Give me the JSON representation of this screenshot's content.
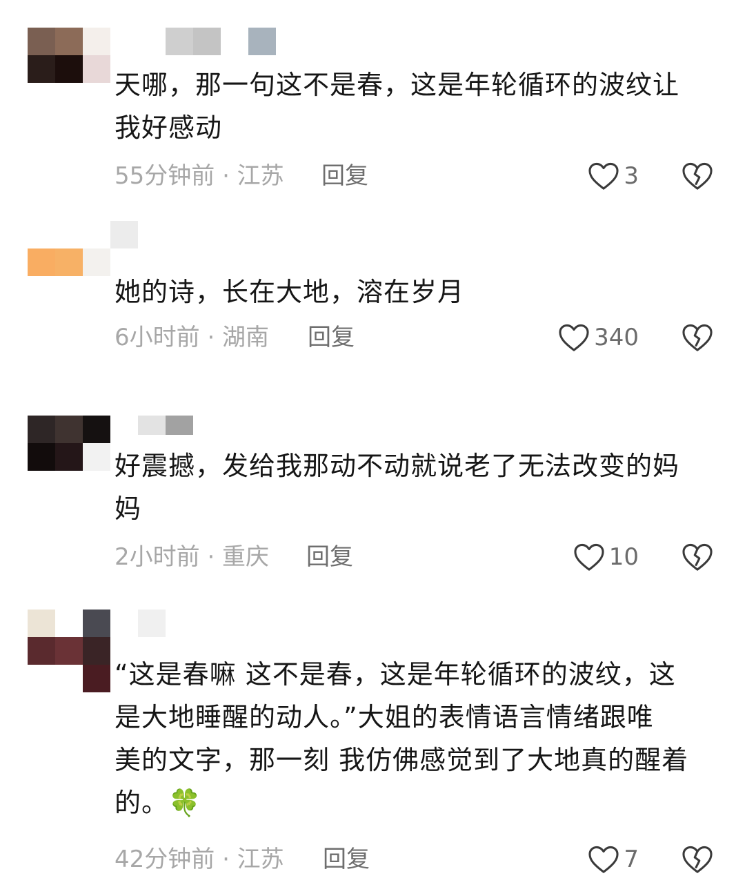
{
  "comments": [
    {
      "text_lines": [
        "天哪，那一句这不是春，这是年轮循环的波纹让",
        "我好感动"
      ],
      "time_location": "55分钟前 · 江苏",
      "reply_label": "回复",
      "likes": "3"
    },
    {
      "text_lines": [
        "她的诗，长在大地，溶在岁月"
      ],
      "time_location": "6小时前 · 湖南",
      "reply_label": "回复",
      "likes": "340"
    },
    {
      "text_lines": [
        "好震撼，发给我那动不动就说老了无法改变的妈",
        "妈"
      ],
      "time_location": "2小时前 · 重庆",
      "reply_label": "回复",
      "likes": "10"
    },
    {
      "text_lines": [
        "“这是春嘛 这不是春，这是年轮循环的波纹，这",
        "是大地睡醒的动人。”大姐的表情语言情绪跟唯",
        "美的文字，那一刻 我仿佛感觉到了大地真的醒着",
        "的。🍀"
      ],
      "time_location": "42分钟前 · 江苏",
      "reply_label": "回复",
      "likes": "7"
    }
  ],
  "icons": {
    "like": "heart-outline-icon",
    "dislike": "broken-heart-icon",
    "emoji": "four-leaf-clover"
  },
  "colors": {
    "text": "#161616",
    "meta": "#a7a7a7",
    "reply": "#6e6e6e",
    "icon_stroke": "#3a3a3a"
  }
}
